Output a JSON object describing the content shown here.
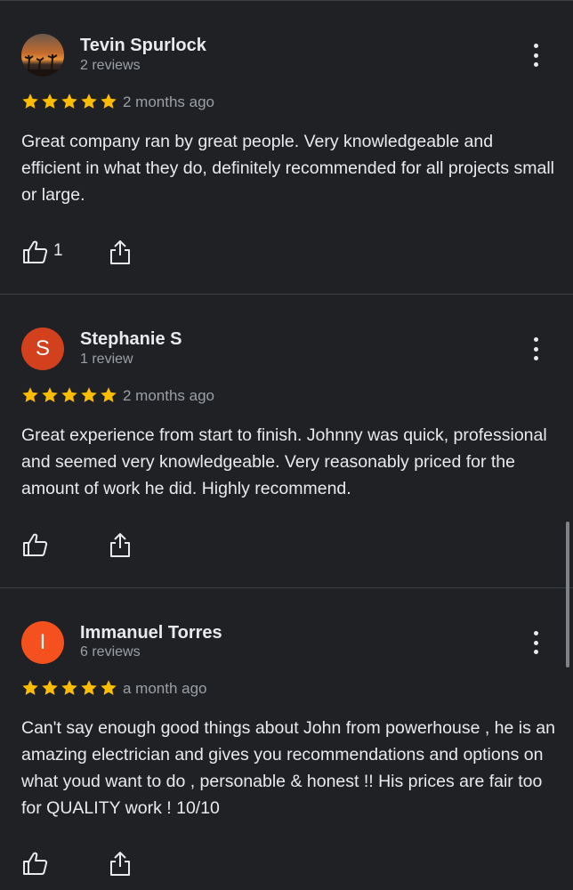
{
  "reviews": [
    {
      "name": "Tevin Spurlock",
      "count": "2 reviews",
      "avatar_letter": "",
      "avatar_color": "#c46a2c",
      "rating": 5,
      "date": "2 months ago",
      "text": "Great company ran by great people. Very knowledgeable and efficient in what they do, definitely recommended for all projects small or large.",
      "likes": "1"
    },
    {
      "name": "Stephanie S",
      "count": "1 review",
      "avatar_letter": "S",
      "avatar_color": "#d2401e",
      "rating": 5,
      "date": "2 months ago",
      "text": "Great experience from start to finish. Johnny was quick, professional and seemed very knowledgeable. Very reasonably priced for the amount of work he did. Highly recommend.",
      "likes": ""
    },
    {
      "name": "Immanuel Torres",
      "count": "6 reviews",
      "avatar_letter": "I",
      "avatar_color": "#f4511e",
      "rating": 5,
      "date": "a month ago",
      "text": "Can't say enough good things about John from powerhouse , he is an amazing electrician and gives you recommendations and options on what youd want to do , personable & honest !! His prices are fair too for QUALITY work ! 10/10",
      "likes": ""
    }
  ],
  "colors": {
    "star": "#fbbc04",
    "background": "#202124"
  }
}
